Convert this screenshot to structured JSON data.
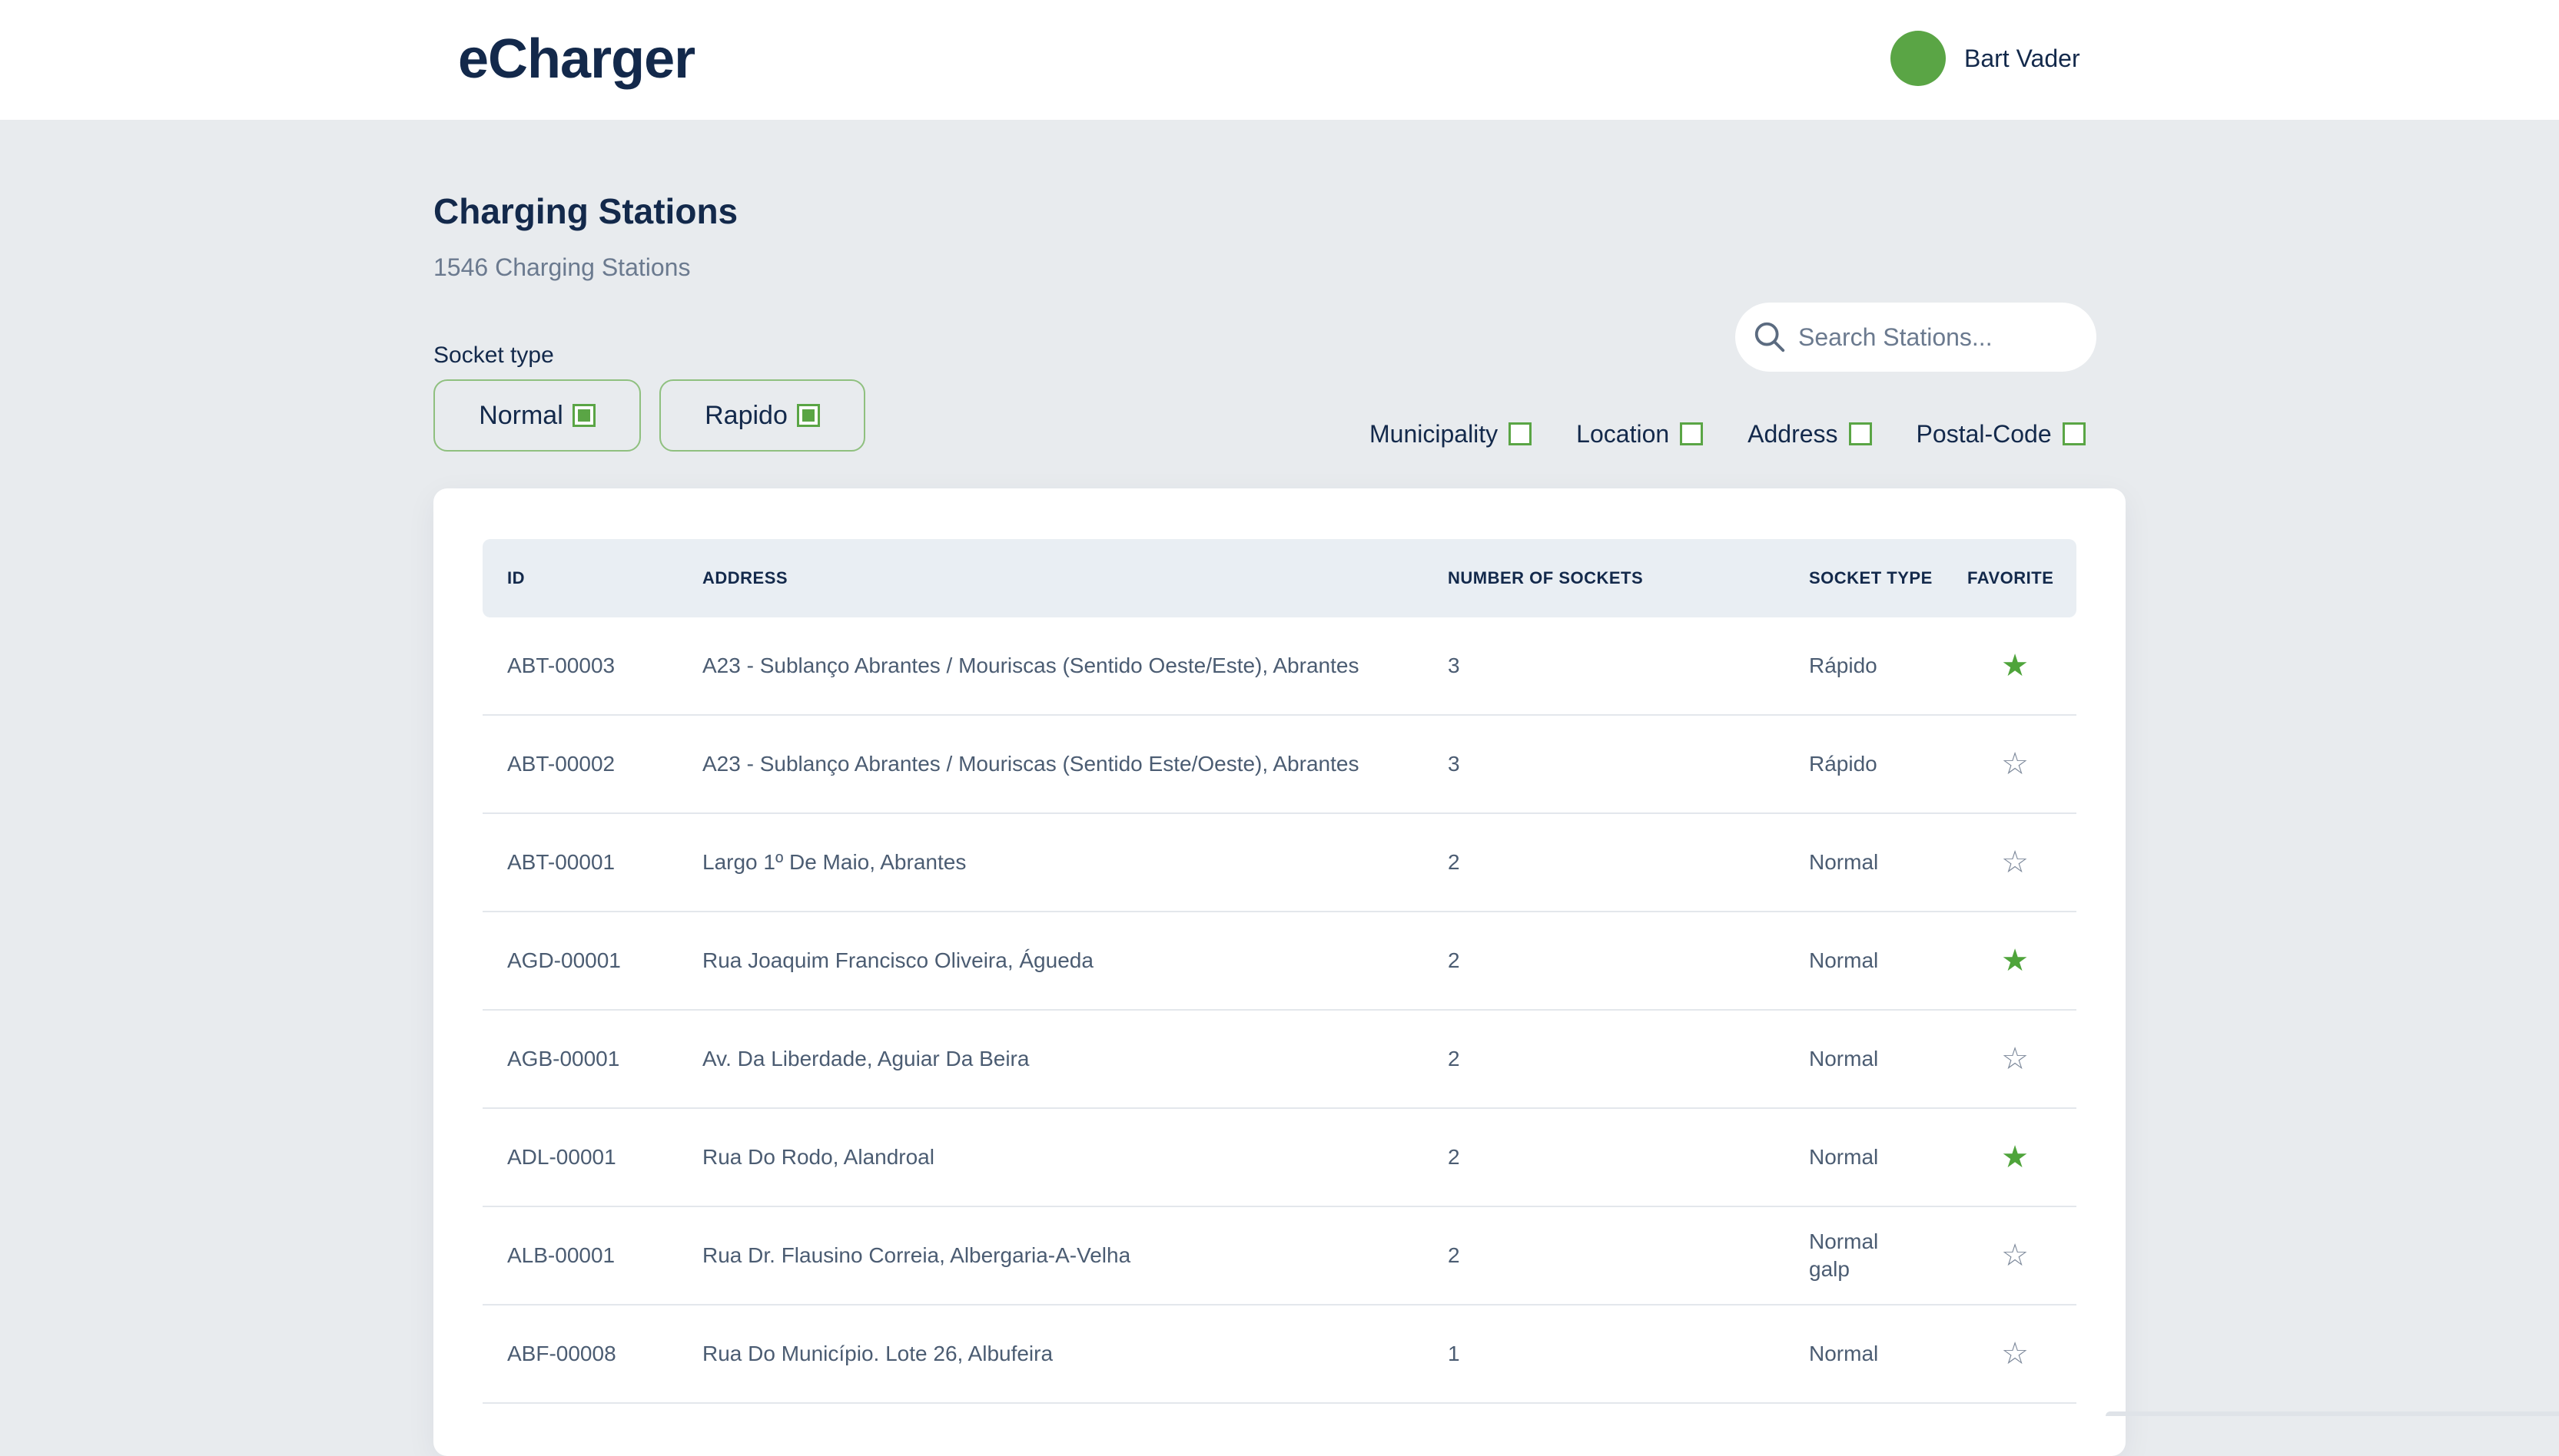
{
  "header": {
    "logo": "eCharger",
    "user_name": "Bart Vader"
  },
  "page": {
    "title": "Charging Stations",
    "subtitle": "1546 Charging Stations"
  },
  "socket_filter": {
    "label": "Socket type",
    "options": [
      {
        "label": "Normal",
        "checked": true
      },
      {
        "label": "Rapido",
        "checked": true
      }
    ]
  },
  "search": {
    "placeholder": "Search Stations..."
  },
  "search_filters": [
    {
      "label": "Municipality",
      "checked": false
    },
    {
      "label": "Location",
      "checked": false
    },
    {
      "label": "Address",
      "checked": false
    },
    {
      "label": "Postal-Code",
      "checked": false
    }
  ],
  "table": {
    "columns": [
      "ID",
      "ADDRESS",
      "NUMBER OF SOCKETS",
      "SOCKET TYPE",
      "FAVORITE"
    ],
    "rows": [
      {
        "id": "ABT-00003",
        "address": "A23 - Sublanço Abrantes / Mouriscas (Sentido Oeste/Este), Abrantes",
        "sockets": "3",
        "type": "Rápido",
        "type2": "",
        "favorite": true
      },
      {
        "id": "ABT-00002",
        "address": "A23 - Sublanço Abrantes / Mouriscas (Sentido Este/Oeste), Abrantes",
        "sockets": "3",
        "type": "Rápido",
        "type2": "",
        "favorite": false
      },
      {
        "id": "ABT-00001",
        "address": "Largo 1º De Maio, Abrantes",
        "sockets": "2",
        "type": "Normal",
        "type2": "",
        "favorite": false
      },
      {
        "id": "AGD-00001",
        "address": "Rua Joaquim Francisco Oliveira, Águeda",
        "sockets": "2",
        "type": "Normal",
        "type2": "",
        "favorite": true
      },
      {
        "id": "AGB-00001",
        "address": "Av. Da Liberdade, Aguiar Da Beira",
        "sockets": "2",
        "type": "Normal",
        "type2": "",
        "favorite": false
      },
      {
        "id": "ADL-00001",
        "address": "Rua Do Rodo, Alandroal",
        "sockets": "2",
        "type": "Normal",
        "type2": "",
        "favorite": true
      },
      {
        "id": "ALB-00001",
        "address": "Rua Dr. Flausino Correia, Albergaria-A-Velha",
        "sockets": "2",
        "type": "Normal",
        "type2": "galp",
        "favorite": false
      },
      {
        "id": "ABF-00008",
        "address": "Rua Do Município. Lote 26, Albufeira",
        "sockets": "1",
        "type": "Normal",
        "type2": "",
        "favorite": false
      }
    ]
  },
  "icons": {
    "favorite_on": "star-filled-icon",
    "favorite_off": "star-outline-icon",
    "search": "search-icon"
  },
  "colors": {
    "accent": "#5aa545",
    "text_primary": "#13294b",
    "text_secondary": "#4b5c72",
    "background": "#e8ebee"
  }
}
